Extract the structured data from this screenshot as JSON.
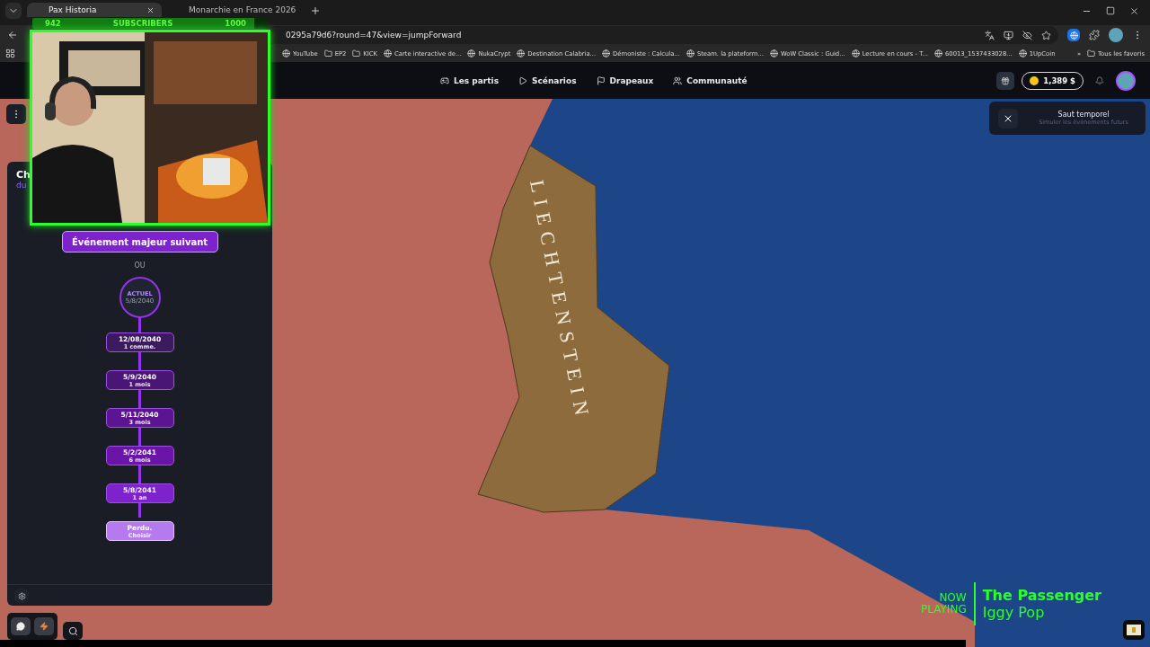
{
  "browser": {
    "tabs": [
      {
        "title": "Pax Historia",
        "selected": true
      },
      {
        "title": "Monarchie en France 2026",
        "selected": false
      }
    ],
    "url": "0295a79d6?round=47&view=jumpForward",
    "bookmarks": [
      {
        "title": "YouTube",
        "kind": "site"
      },
      {
        "title": "EP2",
        "kind": "folder"
      },
      {
        "title": "KICK",
        "kind": "folder"
      },
      {
        "title": "Carte interactive de...",
        "kind": "site"
      },
      {
        "title": "NukaCrypt",
        "kind": "site"
      },
      {
        "title": "Destination Calabria...",
        "kind": "site"
      },
      {
        "title": "Démoniste : Calcula...",
        "kind": "site"
      },
      {
        "title": "Steam. la plateform...",
        "kind": "site"
      },
      {
        "title": "WoW Classic : Guid...",
        "kind": "site"
      },
      {
        "title": "Lecture en cours - T...",
        "kind": "site"
      },
      {
        "title": "60013_1537433028...",
        "kind": "site"
      },
      {
        "title": "1UpCoin",
        "kind": "site"
      }
    ],
    "more": "»",
    "all_bookmarks": "Tous les favoris"
  },
  "subscriber_goal": {
    "count": "942",
    "label": "SUBSCRIBERS",
    "goal": "1000",
    "level": 0.942
  },
  "header": {
    "nav": [
      "Les partis",
      "Scénarios",
      "Drapeaux",
      "Communauté"
    ],
    "balance": "1,389 $"
  },
  "panel": {
    "title": "Ch",
    "subtitle": "du",
    "next_button": "Événement majeur suivant",
    "separator": "OU",
    "current": {
      "label": "ACTUEL",
      "date": "5/8/2040"
    },
    "steps": [
      {
        "date": "12/08/2040",
        "detail": "1 comme.",
        "kind": "jump"
      },
      {
        "date": "5/9/2040",
        "detail": "1 mois",
        "kind": "jump"
      },
      {
        "date": "5/11/2040",
        "detail": "3 mois",
        "kind": "jump"
      },
      {
        "date": "5/2/2041",
        "detail": "6 mois",
        "kind": "jump"
      },
      {
        "date": "5/8/2041",
        "detail": "1 an",
        "kind": "jump"
      },
      {
        "date": "Perdu.",
        "detail": "Choisir",
        "kind": "custom"
      }
    ]
  },
  "toast": {
    "title": "Saut temporel",
    "text": "Simuler les événements futurs"
  },
  "map": {
    "label": "LIECHTENSTEIN"
  },
  "now_playing": {
    "label_lines": [
      "NOW",
      "PLAYING"
    ],
    "title": "The Passenger",
    "artist": "Iggy Pop"
  }
}
